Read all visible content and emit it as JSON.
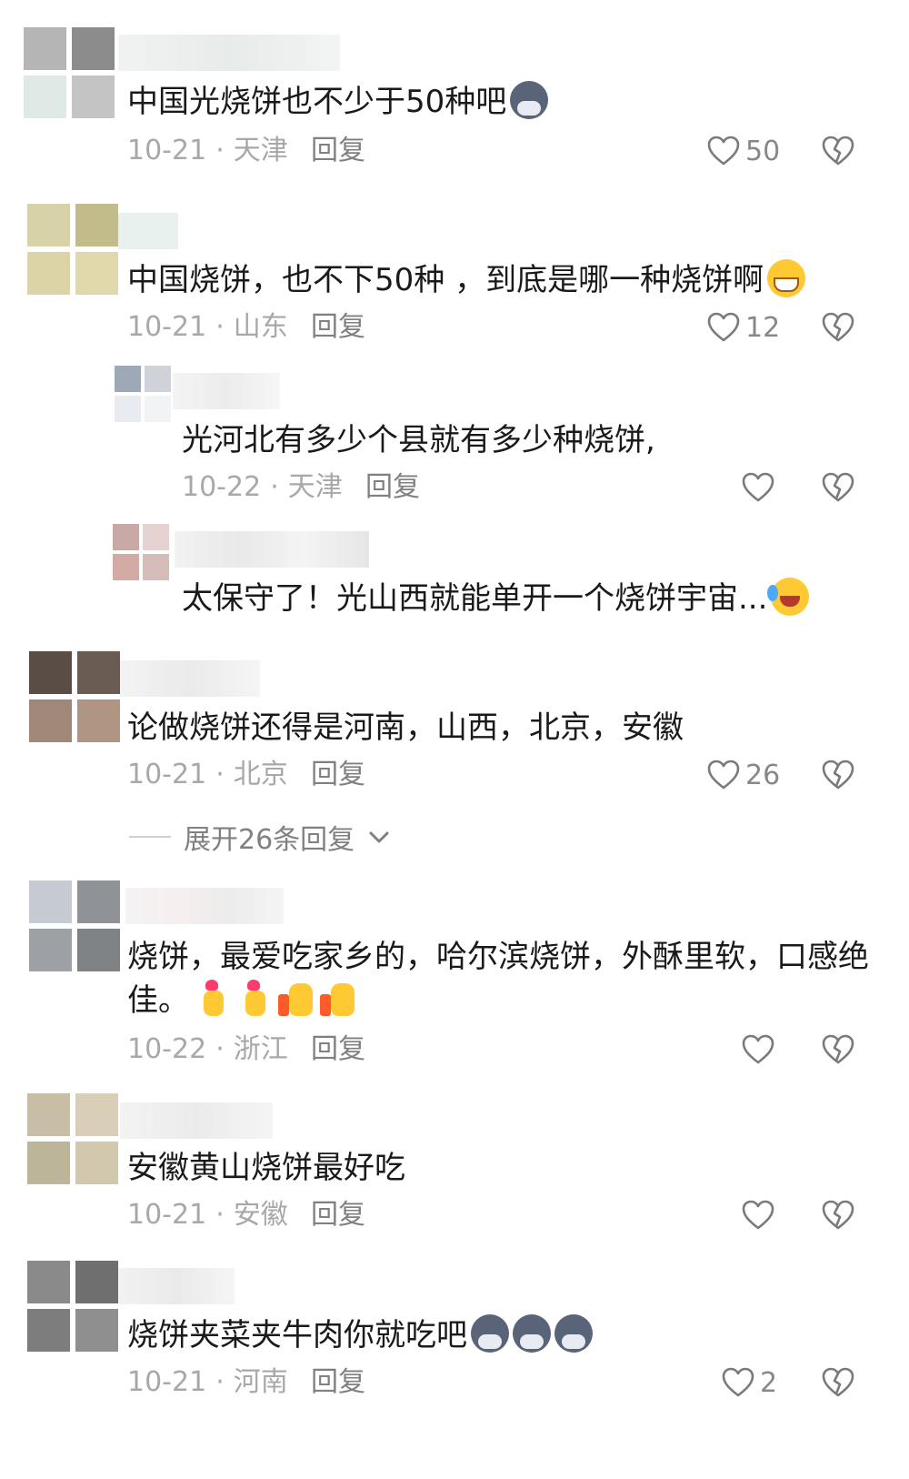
{
  "comments": [
    {
      "text": "中国光烧饼也不少于50种吧",
      "emojis": [
        "wolf"
      ],
      "date": "10-21",
      "location": "天津",
      "reply": "回复",
      "likes": "50",
      "avatar_colors": [
        "#b5b5b5",
        "#8c8c8c",
        "#dfe9e6",
        "#c4c4c4"
      ]
    },
    {
      "text": "中国烧饼，也不下50种 ，到底是哪一种烧饼啊",
      "emojis": [
        "grin"
      ],
      "date": "10-21",
      "location": "山东",
      "reply": "回复",
      "likes": "12",
      "avatar_colors": [
        "#d8d2a8",
        "#c2bb8a",
        "#dcd3a6",
        "#e0d8ab"
      ]
    },
    {
      "text": "光河北有多少个县就有多少种烧饼,",
      "emojis": [],
      "date": "10-22",
      "location": "天津",
      "reply": "回复",
      "likes": "",
      "avatar_colors": [
        "#9fa8b6",
        "#cfd3d9",
        "#e8ebef",
        "#f2f3f5"
      ]
    },
    {
      "text": "太保守了！光山西就能单开一个烧饼宇宙...",
      "emojis": [
        "laughcry"
      ],
      "avatar_colors": [
        "#c9a9a6",
        "#e6d2d0",
        "#d4aaa5",
        "#d6bcb9"
      ]
    },
    {
      "text": "论做烧饼还得是河南，山西，北京，安徽",
      "emojis": [],
      "date": "10-21",
      "location": "北京",
      "reply": "回复",
      "likes": "26",
      "avatar_colors": [
        "#5a4d45",
        "#6a5c53",
        "#a08878",
        "#b09583"
      ]
    },
    {
      "text_line1": "烧饼，最爱吃家乡的，哈尔滨烧饼，外酥里软，口感绝",
      "text_line2": "佳。",
      "emojis": [
        "heart-hand",
        "heart-hand",
        "thumb",
        "thumb"
      ],
      "date": "10-22",
      "location": "浙江",
      "reply": "回复",
      "likes": "",
      "avatar_colors": [
        "#c6cad2",
        "#8f9296",
        "#9da0a4",
        "#7f8386"
      ]
    },
    {
      "text": "安徽黄山烧饼最好吃",
      "emojis": [],
      "date": "10-21",
      "location": "安徽",
      "reply": "回复",
      "likes": "",
      "avatar_colors": [
        "#c8bda5",
        "#d9ceb6",
        "#bcb599",
        "#d2c8ae"
      ]
    },
    {
      "text": "烧饼夹菜夹牛肉你就吃吧",
      "emojis": [
        "wolf",
        "wolf",
        "wolf"
      ],
      "date": "10-21",
      "location": "河南",
      "reply": "回复",
      "likes": "2",
      "avatar_colors": [
        "#8a8a8a",
        "#6f6f6f",
        "#7d7d7d",
        "#8f8f8f"
      ]
    }
  ],
  "expand_replies": "展开26条回复",
  "icons": {
    "like": "heart-outline-icon",
    "dislike": "broken-heart-icon",
    "expand": "chevron-down-icon"
  },
  "colors": {
    "text": "#1a1a1a",
    "meta": "#a8a8a8",
    "icon": "#7a7a7a"
  }
}
